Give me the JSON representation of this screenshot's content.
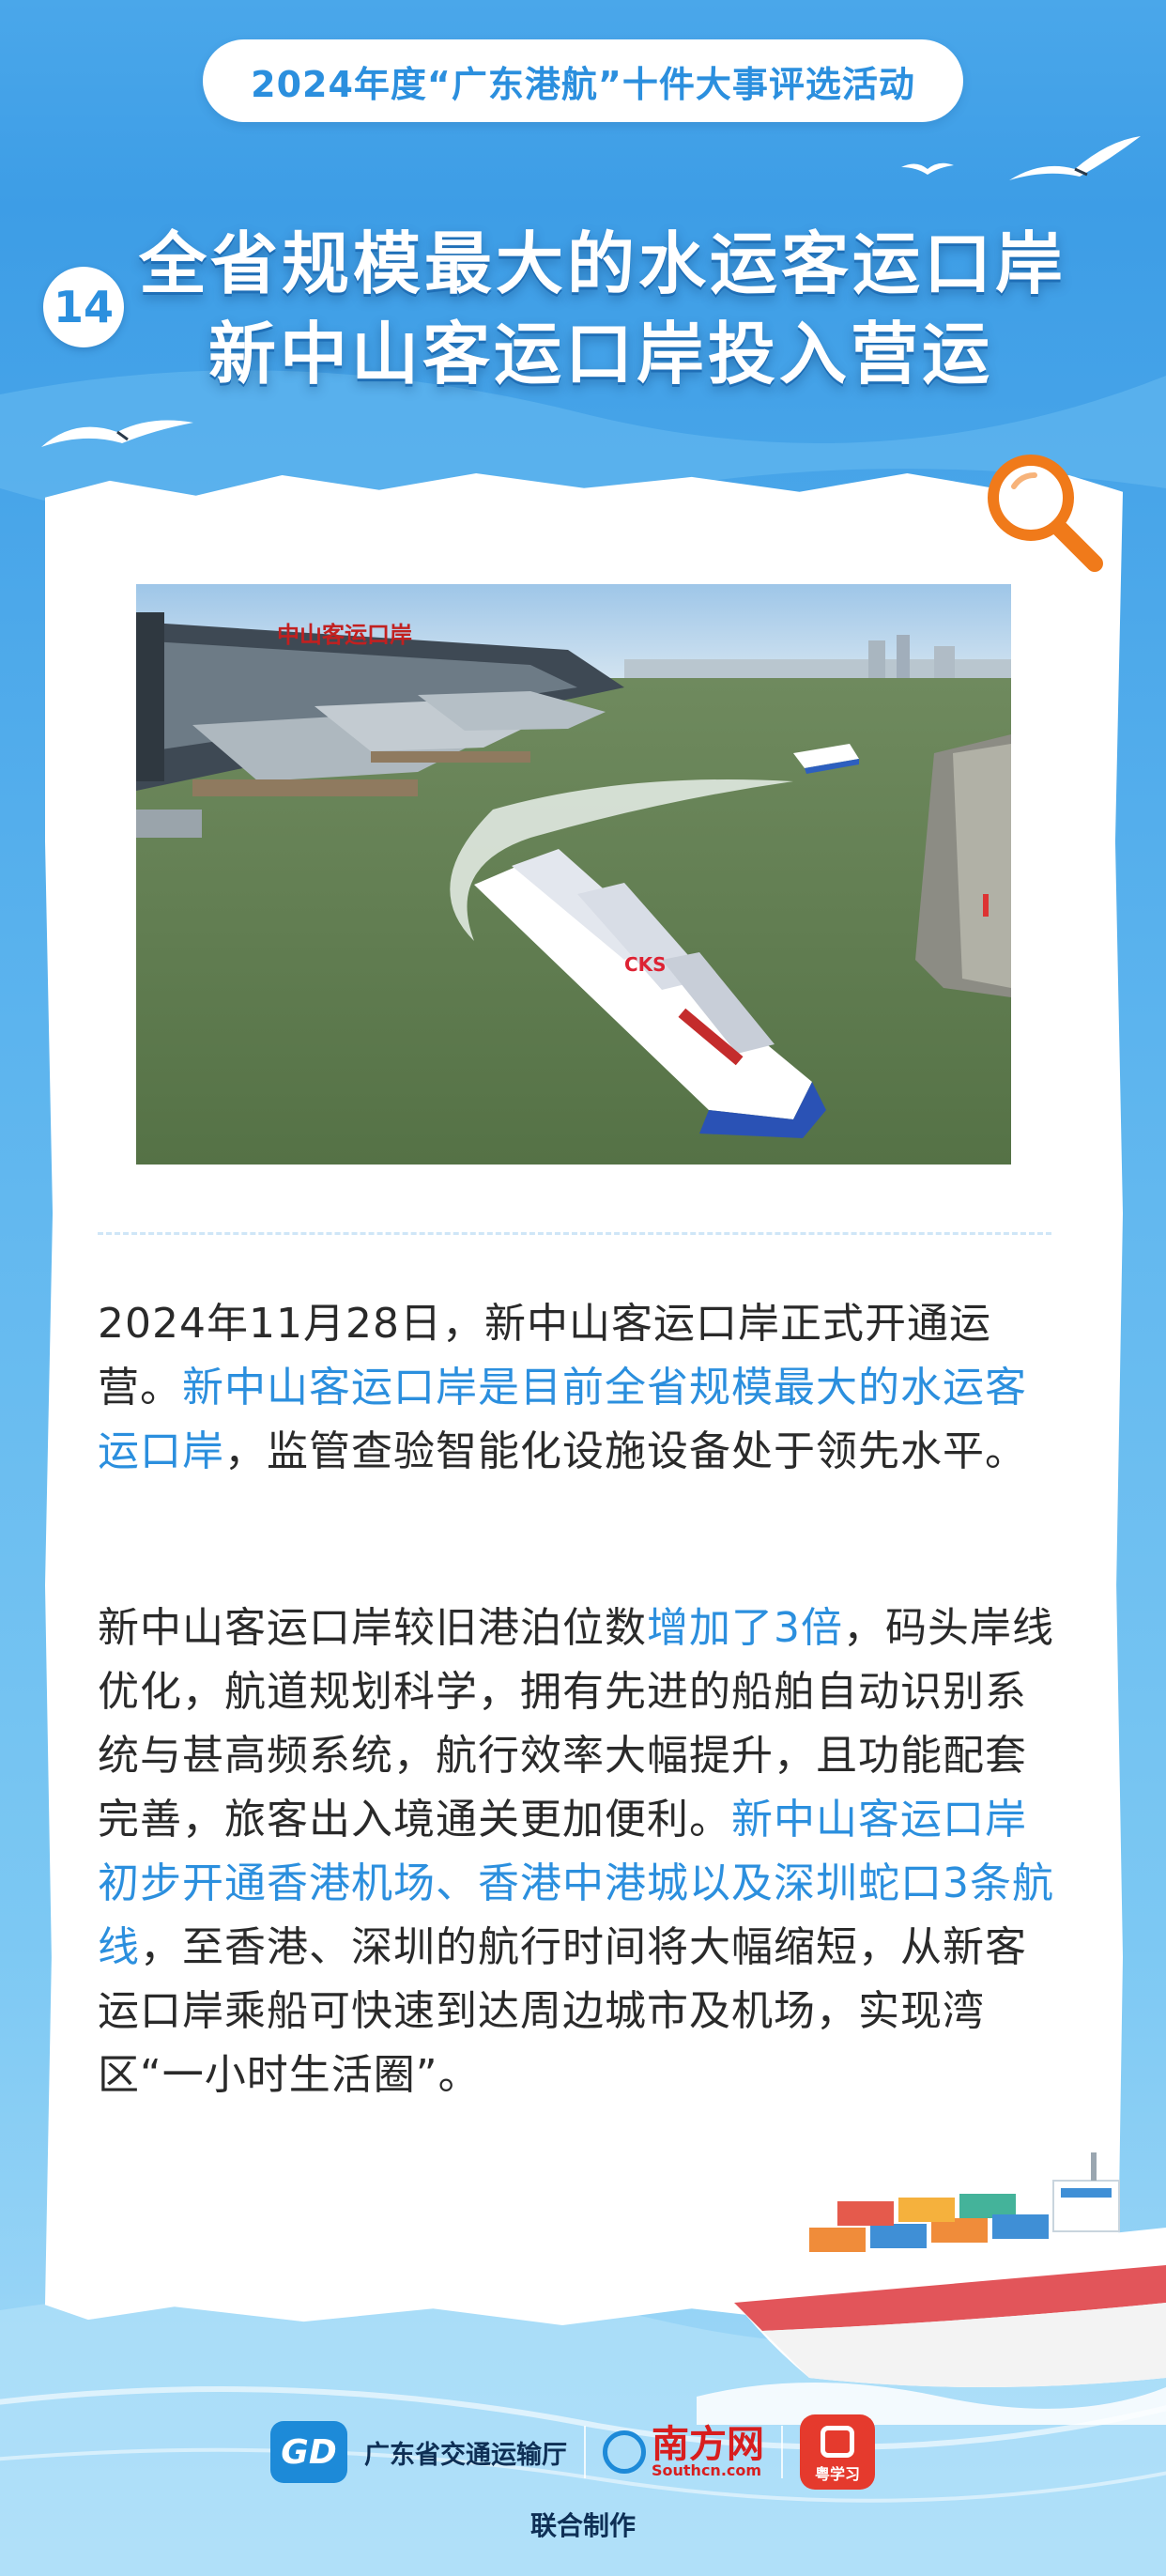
{
  "header": {
    "event_title": "2024年度“广东港航”十件大事评选活动",
    "item_number": "14",
    "title_line1": "全省规模最大的水运客运口岸",
    "title_line2": "新中山客运口岸投入营运"
  },
  "photo": {
    "sign_text": "中山客运口岸",
    "ship_mark": "CKS"
  },
  "body": {
    "p1_a": "2024年11月28日，新中山客运口岸正式开通运营。",
    "p1_b": "新中山客运口岸是目前全省规模最大的水运客运口岸",
    "p1_c": "，监管查验智能化设施设备处于领先水平。",
    "p2_a": "新中山客运口岸较旧港泊位数",
    "p2_b": "增加了3倍",
    "p2_c": "，码头岸线优化，航道规划科学，拥有先进的船舶自动识别系统与甚高频系统，航行效率大幅提升，且功能配套完善，旅客出入境通关更加便利。",
    "p2_d": "新中山客运口岸初步开通香港机场、香港中港城以及深圳蛇口3条航线",
    "p2_e": "，至香港、深圳的航行时间将大幅缩短，从新客运口岸乘船可快速到达周边城市及机场，实现湾区“一小时生活圈”。"
  },
  "footer": {
    "gd_mark": "GD",
    "gd_name": "广东省交通运输厅",
    "nanfang_cn": "南方网",
    "nanfang_en": "Southcn.com",
    "yuexuexi": "粤学习",
    "joint_label": "联合制作"
  },
  "colors": {
    "accent": "#2b8fde",
    "text": "#2a2a2a",
    "sky": "#4aa7ea"
  },
  "icons": [
    "magnifier-icon",
    "seagull-icon",
    "cargo-ship-illustration"
  ]
}
